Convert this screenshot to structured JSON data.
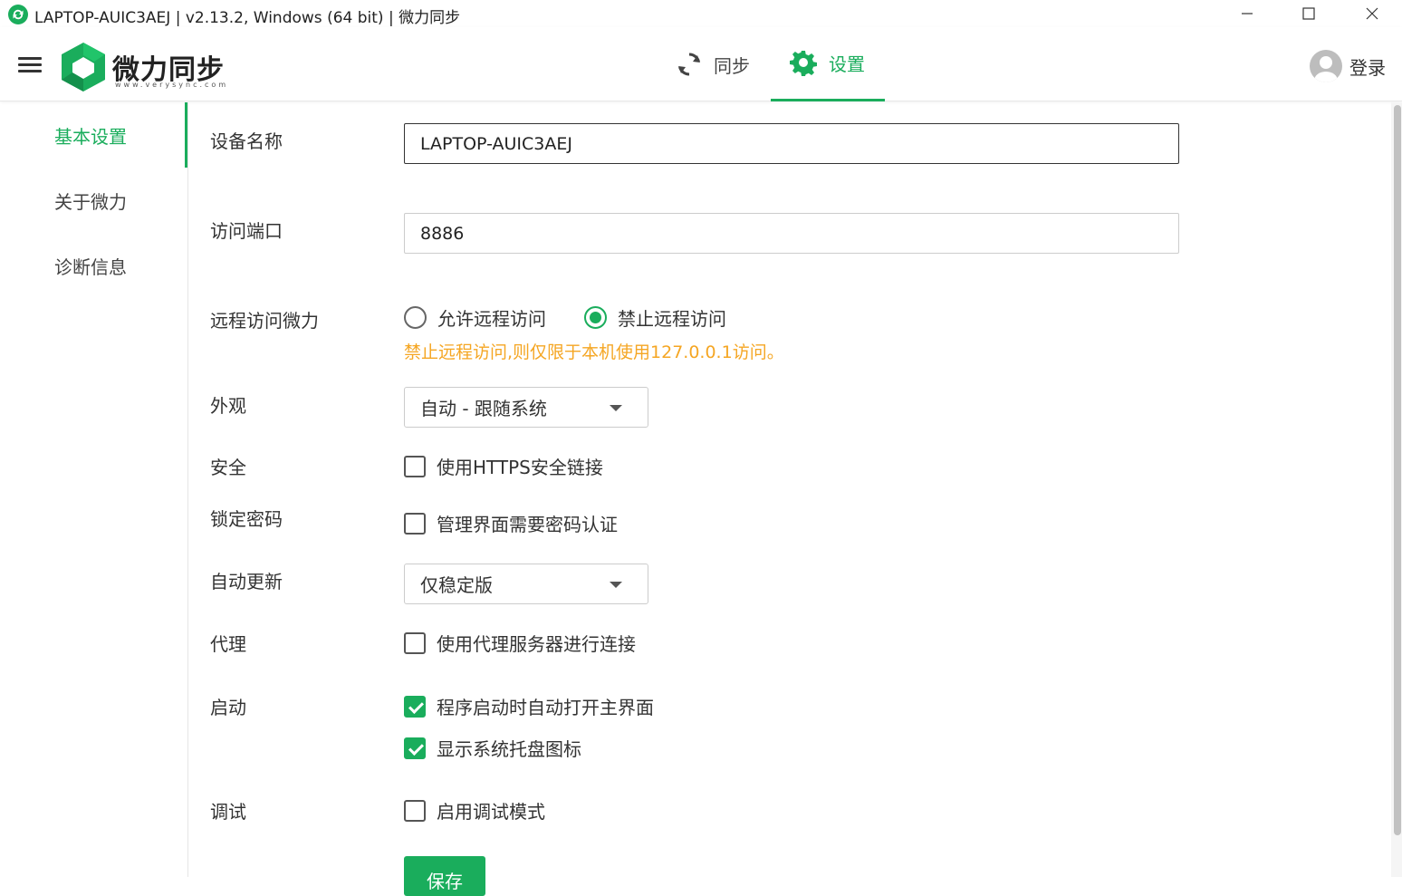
{
  "window": {
    "title": "LAPTOP-AUIC3AEJ | v2.13.2, Windows (64 bit) | 微力同步"
  },
  "header": {
    "logo_text": "微力同步",
    "logo_url": "www.verysync.com",
    "tabs": [
      {
        "label": "同步",
        "icon": "sync-icon"
      },
      {
        "label": "设置",
        "icon": "gear-icon",
        "active": true
      }
    ],
    "login_label": "登录"
  },
  "sidebar": {
    "items": [
      {
        "label": "基本设置",
        "active": true
      },
      {
        "label": "关于微力"
      },
      {
        "label": "诊断信息"
      }
    ]
  },
  "form": {
    "device_name": {
      "label": "设备名称",
      "value": "LAPTOP-AUIC3AEJ"
    },
    "port": {
      "label": "访问端口",
      "value": "8886"
    },
    "remote": {
      "label": "远程访问微力",
      "options": [
        {
          "label": "允许远程访问",
          "selected": false
        },
        {
          "label": "禁止远程访问",
          "selected": true
        }
      ],
      "hint": "禁止远程访问,则仅限于本机使用127.0.0.1访问。"
    },
    "appearance": {
      "label": "外观",
      "value": "自动 - 跟随系统"
    },
    "security": {
      "label": "安全",
      "checkbox": "使用HTTPS安全链接",
      "checked": false
    },
    "lock": {
      "label": "锁定密码",
      "checkbox": "管理界面需要密码认证",
      "checked": false
    },
    "update": {
      "label": "自动更新",
      "value": "仅稳定版"
    },
    "proxy": {
      "label": "代理",
      "checkbox": "使用代理服务器进行连接",
      "checked": false
    },
    "startup": {
      "label": "启动",
      "options": [
        {
          "label": "程序启动时自动打开主界面",
          "checked": true
        },
        {
          "label": "显示系统托盘图标",
          "checked": true
        }
      ]
    },
    "debug": {
      "label": "调试",
      "checkbox": "启用调试模式",
      "checked": false
    },
    "save_label": "保存"
  },
  "colors": {
    "accent": "#1aad5c",
    "hint": "#f5a623"
  }
}
